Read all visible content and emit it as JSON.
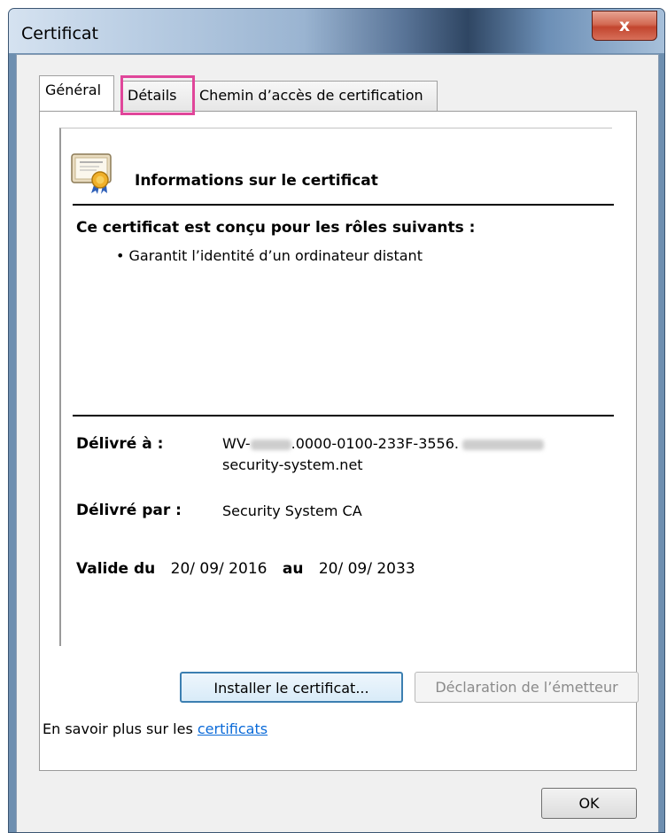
{
  "window": {
    "title": "Certificat",
    "close_symbol": "x"
  },
  "tabs": [
    {
      "label": "Général",
      "active": true
    },
    {
      "label": "Détails",
      "active": false,
      "highlighted": true
    },
    {
      "label": "Chemin d’accès de certification",
      "active": false
    }
  ],
  "info": {
    "icon": "certificate-icon",
    "title": "Informations sur le certificat",
    "purpose_heading": "Ce certificat est conçu pour les rôles suivants :",
    "purposes": [
      "• Garantit l’identité d’un ordinateur distant"
    ]
  },
  "issued_to": {
    "label": "Délivré à :",
    "value_prefix": "WV-",
    "value_middle": ".0000-0100-233F-3556.",
    "value_line2": "security-system.net"
  },
  "issued_by": {
    "label": "Délivré par :",
    "value": "Security System CA"
  },
  "validity": {
    "from_label": "Valide du",
    "from_date": "20/ 09/ 2016",
    "to_label": "au",
    "to_date": "20/ 09/ 2033"
  },
  "buttons": {
    "install": "Installer le certificat...",
    "issuer_statement": "Déclaration de l’émetteur",
    "ok": "OK"
  },
  "learn_more": {
    "text": "En savoir plus sur les ",
    "link": "certificats"
  },
  "colors": {
    "link": "#0a6ad8",
    "highlight": "#e0469a",
    "close_button": "#c2452e"
  }
}
